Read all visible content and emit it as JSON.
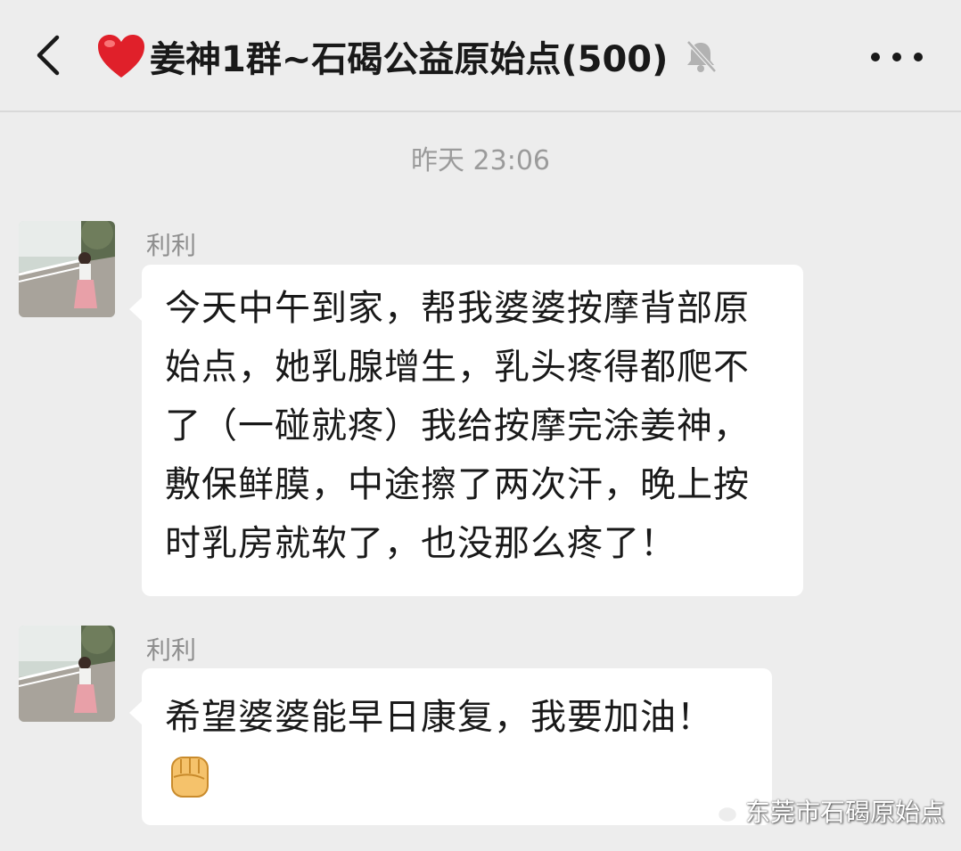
{
  "header": {
    "title": "姜神1群~石碣公益原始点(500)",
    "back_icon": "chevron-left-icon",
    "title_emoji": "heart-icon",
    "mute_icon": "bell-muted-icon",
    "more_icon": "more-dots-icon"
  },
  "chat": {
    "timestamp": "昨天 23:06",
    "messages": [
      {
        "sender": "利利",
        "text": "今天中午到家，帮我婆婆按摩背部原始点，她乳腺增生，乳头疼得都爬不了（一碰就疼）我给按摩完涂姜神，敷保鲜膜，中途擦了两次汗，晚上按时乳房就软了，也没那么疼了！"
      },
      {
        "sender": "利利",
        "text": "希望婆婆能早日康复，我要加油！",
        "emoji": "fist-emoji-icon"
      }
    ]
  },
  "watermark": {
    "text": "东莞市石碣原始点",
    "icon": "wechat-logo-icon"
  },
  "colors": {
    "background": "#ededed",
    "bubble": "#ffffff",
    "heart": "#e0202a",
    "meta_text": "#9b9b9b"
  }
}
